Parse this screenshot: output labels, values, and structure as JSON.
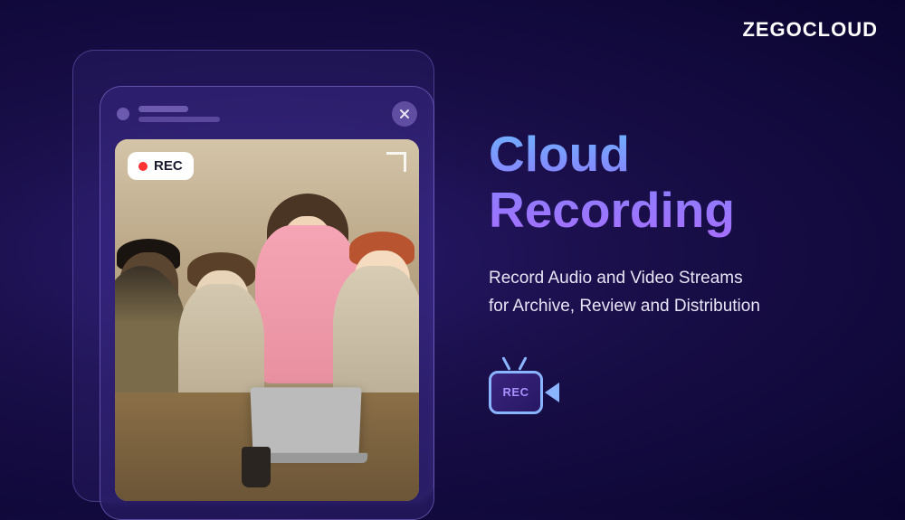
{
  "brand": "ZEGOCLOUD",
  "hero": {
    "title": "Cloud Recording",
    "subtitle_line1": "Record Audio and Video Streams",
    "subtitle_line2": "for Archive, Review and Distribution"
  },
  "rec_badge": {
    "label": "REC"
  },
  "rec_icon": {
    "label": "REC"
  }
}
